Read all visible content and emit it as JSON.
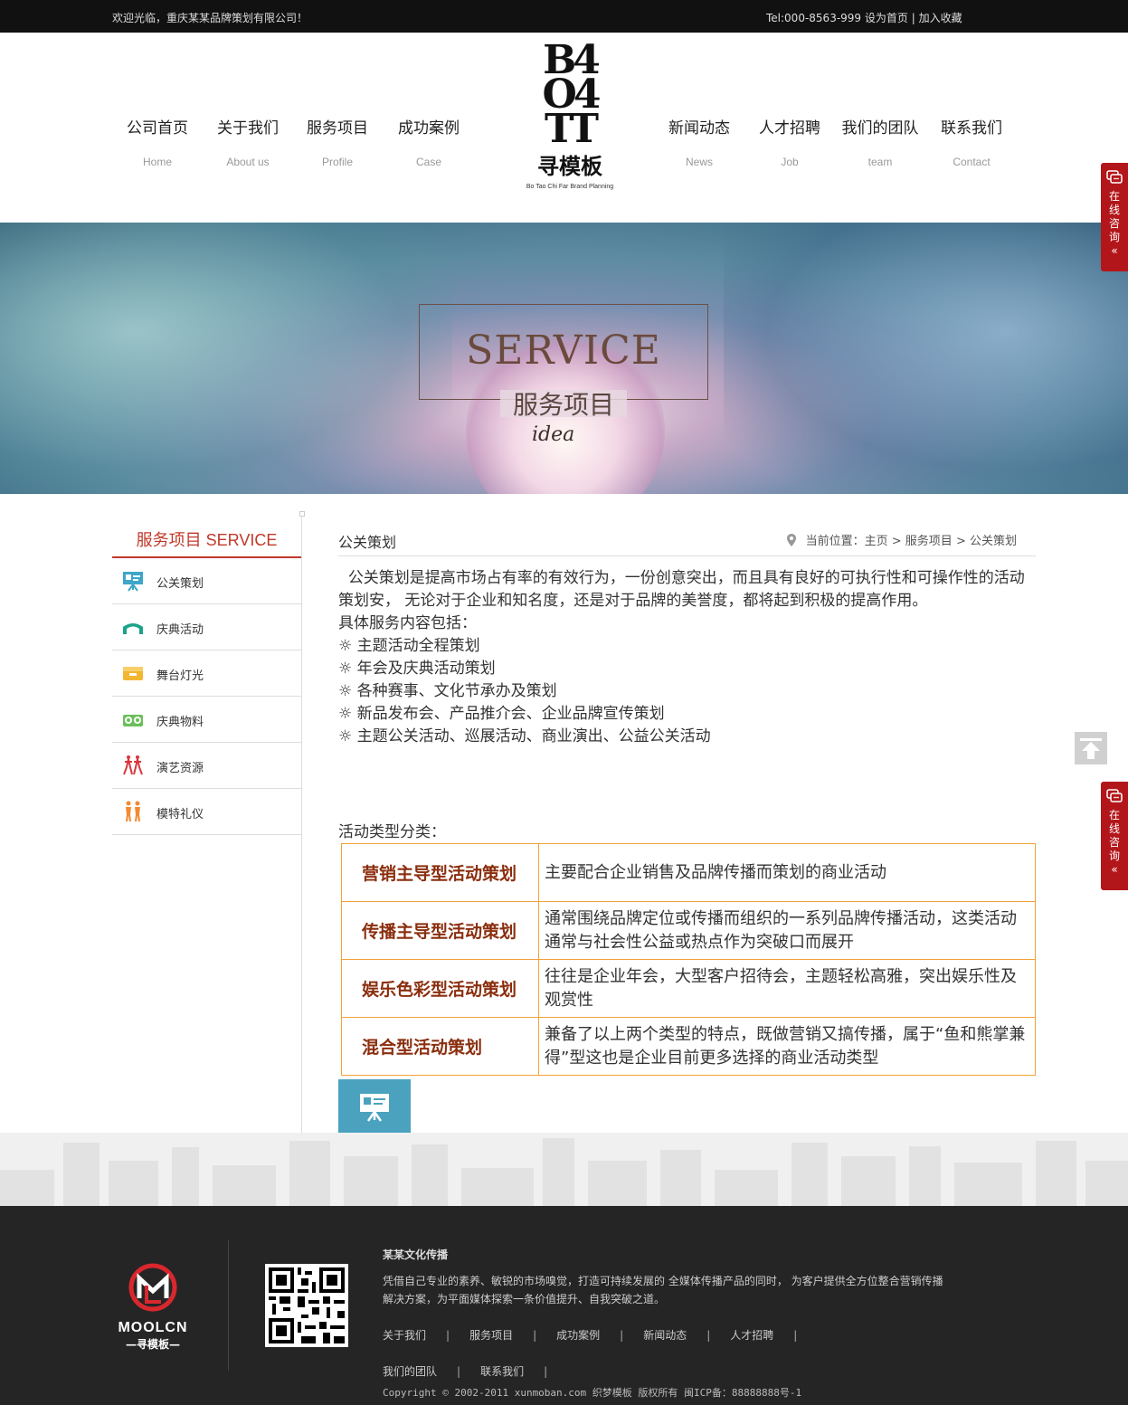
{
  "topbar": {
    "welcome": "欢迎光临，重庆某某品牌策划有限公司！",
    "tel": "Tel:000-8563-999",
    "set_home": "设为首页",
    "separator": "|",
    "favorite": "加入收藏"
  },
  "nav": {
    "left": [
      {
        "cn": "公司首页",
        "en": "Home"
      },
      {
        "cn": "关于我们",
        "en": "About us"
      },
      {
        "cn": "服务项目",
        "en": "Profile"
      },
      {
        "cn": "成功案例",
        "en": "Case"
      }
    ],
    "right": [
      {
        "cn": "新闻动态",
        "en": "News"
      },
      {
        "cn": "人才招聘",
        "en": "Job"
      },
      {
        "cn": "我们的团队",
        "en": "team"
      },
      {
        "cn": "联系我们",
        "en": "Contact"
      }
    ]
  },
  "logo": {
    "mark_line1": "B4",
    "mark_line2": "O4",
    "mark_line3": "TT",
    "name": "寻模板",
    "slogan": "Bo Tao Chi Far Brand Planning"
  },
  "banner": {
    "title_en": "SERVICE",
    "title_cn": "服务项目",
    "script": "idea"
  },
  "sidebar": {
    "title": "服务项目 SERVICE",
    "items": [
      {
        "label": "公关策划",
        "icon": "presentation-board-icon",
        "color": "#3ea6c8"
      },
      {
        "label": "庆典活动",
        "icon": "arch-icon",
        "color": "#1aa38a"
      },
      {
        "label": "舞台灯光",
        "icon": "box-icon",
        "color": "#f2b632"
      },
      {
        "label": "庆典物料",
        "icon": "camera-icon",
        "color": "#6cbf5a"
      },
      {
        "label": "演艺资源",
        "icon": "dancers-icon",
        "color": "#d9363e"
      },
      {
        "label": "模特礼仪",
        "icon": "models-icon",
        "color": "#f28a2e"
      }
    ]
  },
  "main": {
    "page_title": "公关策划",
    "breadcrumb": {
      "prefix": "当前位置：",
      "home": "主页",
      "arrow": ">",
      "section": "服务项目",
      "current": "公关策划"
    },
    "intro": "  公关策划是提高市场占有率的有效行为，一份创意突出，而且具有良好的可执行性和可操作性的活动策划安， 无论对于企业和知名度，还是对于品牌的美誉度，都将起到积极的提高作用。",
    "list_heading": "具体服务内容包括：",
    "list": [
      "☼ 主题活动全程策划",
      "☼ 年会及庆典活动策划",
      "☼ 各种赛事、文化节承办及策划",
      "☼ 新品发布会、产品推介会、企业品牌宣传策划",
      "☼ 主题公关活动、巡展活动、商业演出、公益公关活动"
    ],
    "types_heading": "活动类型分类：",
    "types": [
      {
        "name": "营销主导型活动策划",
        "desc": "主要配合企业销售及品牌传播而策划的商业活动"
      },
      {
        "name": "传播主导型活动策划",
        "desc": "通常围绕品牌定位或传播而组织的一系列品牌传播活动，这类活动通常与社会性公益或热点作为突破口而展开"
      },
      {
        "name": "娱乐色彩型活动策划",
        "desc": "往往是企业年会，大型客户招待会，主题轻松高雅，突出娱乐性及观赏性"
      },
      {
        "name": "混合型活动策划",
        "desc": "兼备了以上两个类型的特点，既做营销又搞传播，属于“鱼和熊掌兼得”型这也是企业目前更多选择的商业活动类型"
      }
    ]
  },
  "float": {
    "consult_chars": [
      "在",
      "线",
      "咨",
      "询"
    ],
    "collapse": "«"
  },
  "footer": {
    "logo_text": "MOOLCN",
    "logo_sub": "—寻模板—",
    "company": "某某文化传播",
    "desc": "凭借自己专业的素养、敏锐的市场嗅觉，打造可持续发展的 全媒体传播产品的同时， 为客户提供全方位整合营销传播解决方案，为平面媒体探索一条价值提升、自我突破之道。",
    "links": [
      "关于我们",
      "服务项目",
      "成功案例",
      "新闻动态",
      "人才招聘",
      "我们的团队",
      "联系我们"
    ],
    "separator": "|",
    "copyright": "Copyright © 2002-2011 xunmoban.com 织梦模板 版权所有 闽ICP备：88888888号-1"
  },
  "colors": {
    "accent_red": "#c0392b",
    "table_border": "#f0a23a",
    "table_key": "#8b2e0e",
    "consult_red": "#b3161a"
  }
}
